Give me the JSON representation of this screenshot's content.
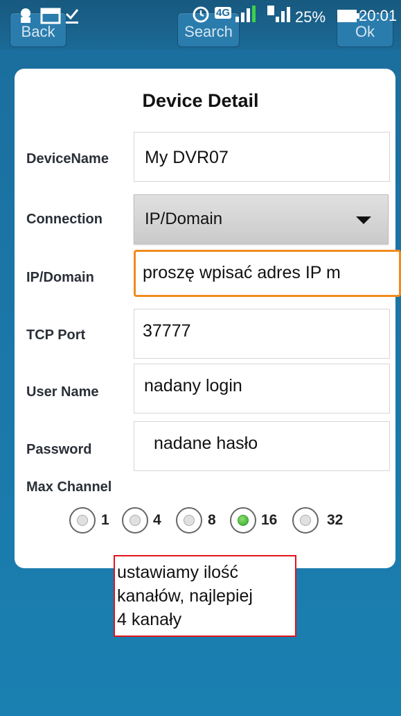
{
  "status_bar": {
    "battery": "25%",
    "time": "20:01",
    "network": "4G"
  },
  "nav": {
    "back": "Back",
    "search": "Search",
    "ok": "Ok"
  },
  "form": {
    "title": "Device Detail",
    "device_name": {
      "label": "DeviceName",
      "value": "My DVR07"
    },
    "connection": {
      "label": "Connection",
      "value": "IP/Domain"
    },
    "ip_domain": {
      "label": "IP/Domain",
      "value": "proszę wpisać adres IP m"
    },
    "tcp_port": {
      "label": "TCP Port",
      "value": "37777"
    },
    "user_name": {
      "label": "User Name",
      "value": "nadany login"
    },
    "password": {
      "label": "Password",
      "value": "nadane hasło"
    },
    "max_channel": {
      "label": "Max Channel",
      "options": [
        "1",
        "4",
        "8",
        "16",
        "32"
      ],
      "selected": "16"
    }
  },
  "annotation": {
    "lines": [
      "ustawiamy ilość",
      "kanałów, najlepiej",
      "4 kanały"
    ]
  },
  "colors": {
    "background": "#1b76a6",
    "focus_border": "#f08b1c",
    "annotation_border": "#e0141b",
    "radio_selected": "#2fa52a"
  }
}
